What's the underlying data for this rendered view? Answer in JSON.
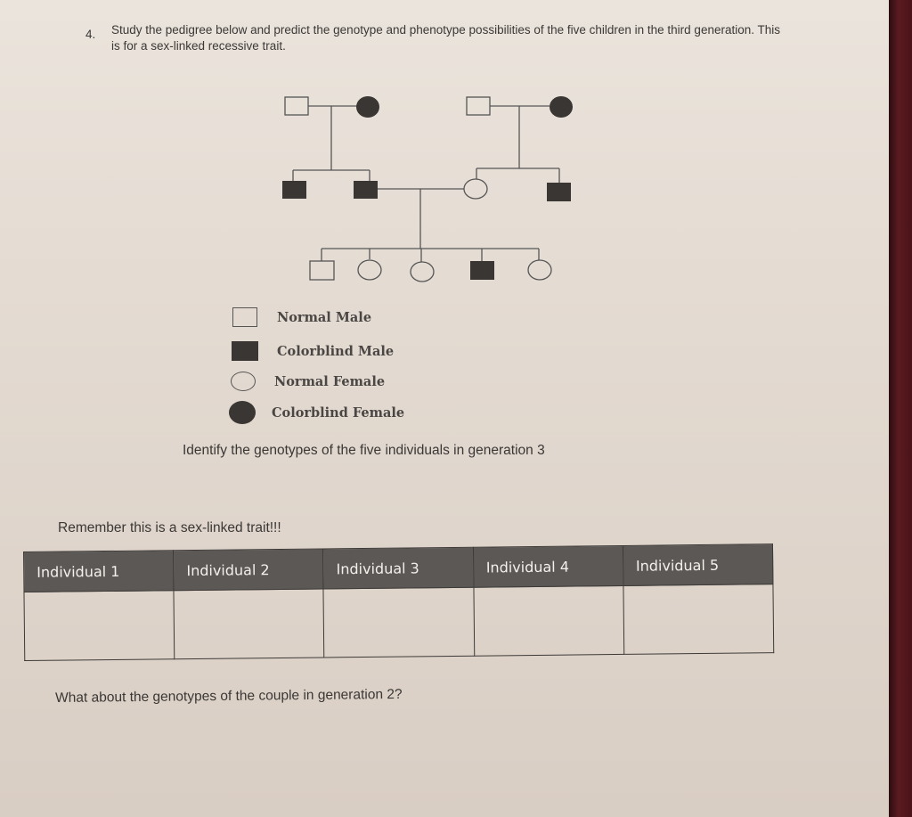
{
  "question": {
    "number": "4.",
    "text": "Study the pedigree below and predict the genotype and phenotype possibilities of the five children in the third generation. This is for a sex-linked recessive trait."
  },
  "pedigree": {
    "trait": "colorblindness (sex-linked recessive)",
    "generation_1": [
      {
        "id": "g1-left-father",
        "sex": "male",
        "affected": false
      },
      {
        "id": "g1-left-mother",
        "sex": "female",
        "affected": true
      },
      {
        "id": "g1-right-father",
        "sex": "male",
        "affected": false
      },
      {
        "id": "g1-right-mother",
        "sex": "female",
        "affected": true
      }
    ],
    "generation_2": [
      {
        "id": "g2-son-1",
        "sex": "male",
        "affected": true
      },
      {
        "id": "g2-son-2",
        "sex": "male",
        "affected": true
      },
      {
        "id": "g2-daughter",
        "sex": "female",
        "affected": false
      },
      {
        "id": "g2-son-3",
        "sex": "male",
        "affected": true
      }
    ],
    "generation_3": [
      {
        "id": "individual-1",
        "sex": "male",
        "affected": false
      },
      {
        "id": "individual-2",
        "sex": "female",
        "affected": false
      },
      {
        "id": "individual-3",
        "sex": "female",
        "affected": false
      },
      {
        "id": "individual-4",
        "sex": "male",
        "affected": true
      },
      {
        "id": "individual-5",
        "sex": "female",
        "affected": false
      }
    ],
    "colors": {
      "affected": "#3a3634",
      "line": "#555555"
    }
  },
  "legend": [
    {
      "symbol": "open-square",
      "label": "Normal Male"
    },
    {
      "symbol": "filled-square",
      "label": "Colorblind Male"
    },
    {
      "symbol": "open-circle",
      "label": "Normal Female"
    },
    {
      "symbol": "filled-circle",
      "label": "Colorblind Female"
    }
  ],
  "instruction": "Identify the genotypes of the five individuals in generation 3",
  "reminder": "Remember this is a sex-linked trait!!!",
  "answer_table": {
    "headers": [
      "Individual 1",
      "Individual 2",
      "Individual 3",
      "Individual 4",
      "Individual 5"
    ],
    "values": [
      "",
      "",
      "",
      "",
      ""
    ]
  },
  "followup_question": "What about the genotypes of the couple in generation 2?"
}
